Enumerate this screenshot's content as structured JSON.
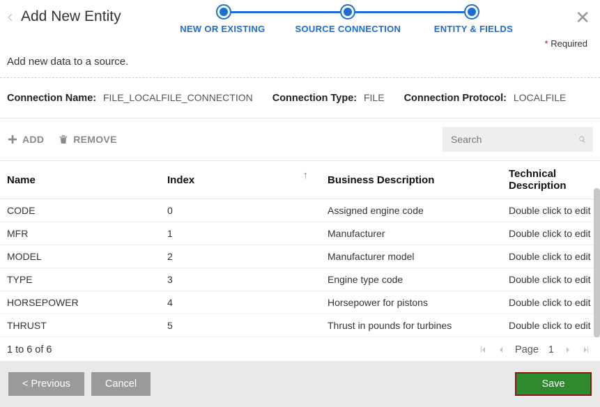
{
  "header": {
    "title": "Add New Entity",
    "steps": [
      "NEW OR EXISTING",
      "SOURCE CONNECTION",
      "ENTITY & FIELDS"
    ],
    "required_label": "Required"
  },
  "subtitle": "Add new data to a source.",
  "connection": {
    "name_label": "Connection Name:",
    "name_value": "FILE_LOCALFILE_CONNECTION",
    "type_label": "Connection Type:",
    "type_value": "FILE",
    "protocol_label": "Connection Protocol:",
    "protocol_value": "LOCALFILE"
  },
  "toolbar": {
    "add_label": "ADD",
    "remove_label": "REMOVE",
    "search_placeholder": "Search"
  },
  "columns": {
    "name": "Name",
    "index": "Index",
    "business": "Business Description",
    "technical": "Technical Description"
  },
  "rows": [
    {
      "name": "CODE",
      "index": "0",
      "business": "Assigned engine code",
      "technical": "Double click to edit"
    },
    {
      "name": "MFR",
      "index": "1",
      "business": "Manufacturer",
      "technical": "Double click to edit"
    },
    {
      "name": "MODEL",
      "index": "2",
      "business": "Manufacturer model",
      "technical": "Double click to edit"
    },
    {
      "name": "TYPE",
      "index": "3",
      "business": "Engine type code",
      "technical": "Double click to edit"
    },
    {
      "name": "HORSEPOWER",
      "index": "4",
      "business": "Horsepower for pistons",
      "technical": "Double click to edit"
    },
    {
      "name": "THRUST",
      "index": "5",
      "business": "Thrust in pounds for turbines",
      "technical": "Double click to edit"
    }
  ],
  "pager": {
    "info": "1 to 6 of 6",
    "page_label": "Page",
    "page_number": "1"
  },
  "footer": {
    "previous": "< Previous",
    "cancel": "Cancel",
    "save": "Save"
  }
}
